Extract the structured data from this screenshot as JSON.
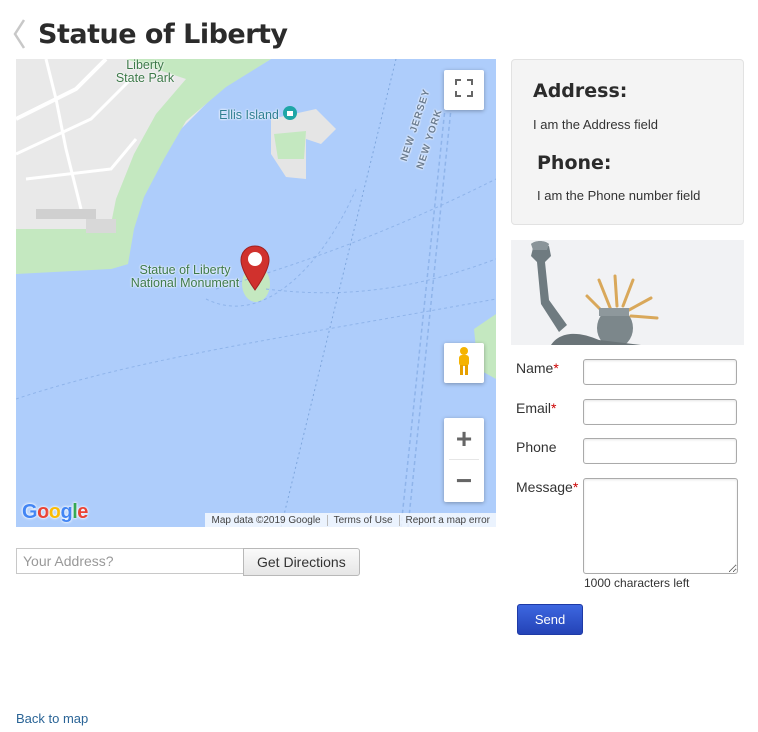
{
  "header": {
    "title": "Statue of Liberty",
    "back_icon": "chevron-left-icon"
  },
  "map": {
    "labels": {
      "park": "Liberty\nState Park",
      "ellis": "Ellis Island",
      "monument": "Statue of Liberty\nNational Monument",
      "nj": "NEW JERSEY",
      "ny": "NEW YORK"
    },
    "logo": "Google",
    "attribution": {
      "data": "Map data ©2019 Google",
      "terms": "Terms of Use",
      "report": "Report a map error"
    },
    "controls": {
      "fullscreen_icon": "fullscreen-icon",
      "pegman_icon": "street-view-pegman-icon",
      "zoom_in": "+",
      "zoom_out": "−"
    },
    "colors": {
      "water": "#aecdfb",
      "land": "#e8e8e8",
      "park": "#c4e8c0",
      "marker": "#d0312d"
    }
  },
  "directions": {
    "placeholder": "Your Address?",
    "button_label": "Get Directions"
  },
  "info": {
    "address_heading": "Address:",
    "address_text": "I am the Address field",
    "phone_heading": "Phone:",
    "phone_text": "I am the Phone number field"
  },
  "form": {
    "name_label": "Name",
    "email_label": "Email",
    "phone_label": "Phone",
    "message_label": "Message",
    "required_mark": "*",
    "char_count": "1000 characters left",
    "send_label": "Send"
  },
  "footer": {
    "back_link": "Back to map"
  }
}
